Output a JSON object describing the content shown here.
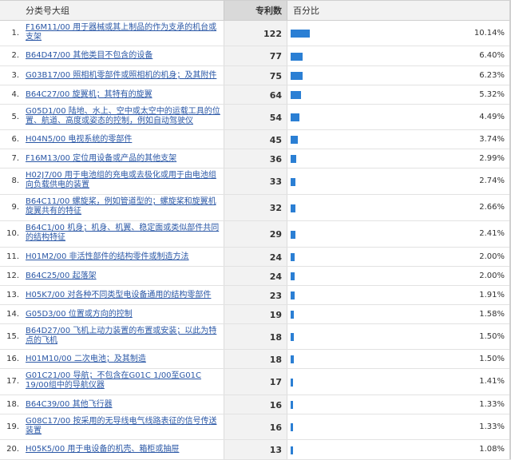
{
  "header": {
    "category_label": "分类号大组",
    "count_label": "专利数",
    "percent_label": "百分比"
  },
  "chart_data": {
    "type": "table",
    "columns": [
      "分类号大组",
      "专利数",
      "百分比"
    ],
    "rows": [
      {
        "rank": "1.",
        "category": "F16M11/00 用于器械或其上制品的作为支承的机台或支架",
        "count": 122,
        "percent": "10.14%"
      },
      {
        "rank": "2.",
        "category": "B64D47/00 其他类目不包含的设备",
        "count": 77,
        "percent": "6.40%"
      },
      {
        "rank": "3.",
        "category": "G03B17/00 照相机零部件或照相机的机身；及其附件",
        "count": 75,
        "percent": "6.23%"
      },
      {
        "rank": "4.",
        "category": "B64C27/00 旋翼机；其特有的旋翼",
        "count": 64,
        "percent": "5.32%"
      },
      {
        "rank": "5.",
        "category": "G05D1/00 陆地、水上、空中或太空中的运载工具的位置、航道、高度或姿态的控制，例如自动驾驶仪",
        "count": 54,
        "percent": "4.49%"
      },
      {
        "rank": "6.",
        "category": "H04N5/00 电视系统的零部件",
        "count": 45,
        "percent": "3.74%"
      },
      {
        "rank": "7.",
        "category": "F16M13/00 定位用设备或产品的其他支架",
        "count": 36,
        "percent": "2.99%"
      },
      {
        "rank": "8.",
        "category": "H02J7/00 用于电池组的充电或去极化或用于由电池组向负载供电的装置",
        "count": 33,
        "percent": "2.74%"
      },
      {
        "rank": "9.",
        "category": "B64C11/00 螺旋桨，例如管道型的；螺旋桨和旋翼机旋翼共有的特征",
        "count": 32,
        "percent": "2.66%"
      },
      {
        "rank": "10.",
        "category": "B64C1/00 机身；机身、机翼、稳定面或类似部件共同的结构特征",
        "count": 29,
        "percent": "2.41%"
      },
      {
        "rank": "11.",
        "category": "H01M2/00 非活性部件的结构零件或制造方法",
        "count": 24,
        "percent": "2.00%"
      },
      {
        "rank": "12.",
        "category": "B64C25/00 起落架",
        "count": 24,
        "percent": "2.00%"
      },
      {
        "rank": "13.",
        "category": "H05K7/00 对各种不同类型电设备通用的结构零部件",
        "count": 23,
        "percent": "1.91%"
      },
      {
        "rank": "14.",
        "category": "G05D3/00 位置或方向的控制",
        "count": 19,
        "percent": "1.58%"
      },
      {
        "rank": "15.",
        "category": "B64D27/00 飞机上动力装置的布置或安装；以此为特点的飞机",
        "count": 18,
        "percent": "1.50%"
      },
      {
        "rank": "16.",
        "category": "H01M10/00 二次电池；及其制造",
        "count": 18,
        "percent": "1.50%"
      },
      {
        "rank": "17.",
        "category": "G01C21/00 导航；不包含在G01C 1/00至G01C 19/00组中的导航仪器",
        "count": 17,
        "percent": "1.41%"
      },
      {
        "rank": "18.",
        "category": "B64C39/00 其他飞行器",
        "count": 16,
        "percent": "1.33%"
      },
      {
        "rank": "19.",
        "category": "G08C17/00 按采用的无导线电气线路表征的信号传送装置",
        "count": 16,
        "percent": "1.33%"
      },
      {
        "rank": "20.",
        "category": "H05K5/00 用于电设备的机壳、箱柜或抽屉",
        "count": 13,
        "percent": "1.08%"
      }
    ],
    "bar_color": "#2b7fd4"
  }
}
